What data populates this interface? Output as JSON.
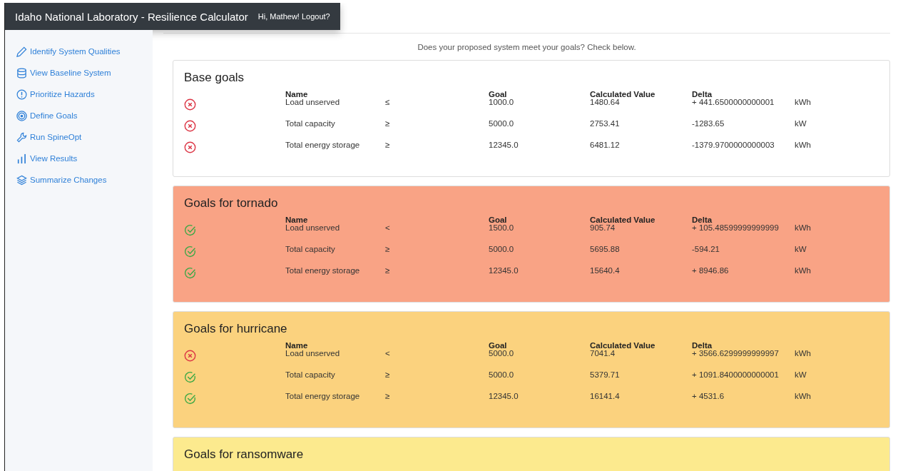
{
  "header": {
    "title": "Idaho National Laboratory - Resilience Calculator",
    "user_link": "Hi, Mathew! Logout?"
  },
  "sidebar": {
    "items": [
      {
        "label": "Identify System Qualities"
      },
      {
        "label": "View Baseline System"
      },
      {
        "label": "Prioritize Hazards"
      },
      {
        "label": "Define Goals"
      },
      {
        "label": "Run SpineOpt"
      },
      {
        "label": "View Results"
      },
      {
        "label": "Summarize Changes"
      }
    ]
  },
  "intro": "Does your proposed system meet your goals? Check below.",
  "cards": [
    {
      "title": "Base goals",
      "color": "#ffffff",
      "columns": [
        "Name",
        "Goal",
        "Calculated Value",
        "Delta"
      ],
      "rows": [
        {
          "met": false,
          "name": "Load unserved",
          "operator": "≤",
          "goal": "1000.0",
          "value": "1480.64",
          "delta": "+ 441.6500000000001",
          "unit": "kWh"
        },
        {
          "met": false,
          "name": "Total capacity",
          "operator": "≥",
          "goal": "5000.0",
          "value": "2753.41",
          "delta": "-1283.65",
          "unit": "kW"
        },
        {
          "met": false,
          "name": "Total energy storage",
          "operator": "≥",
          "goal": "12345.0",
          "value": "6481.12",
          "delta": "-1379.9700000000003",
          "unit": "kWh"
        }
      ]
    },
    {
      "title": "Goals for tornado",
      "color": "#f9a385",
      "columns": [
        "Name",
        "Goal",
        "Calculated Value",
        "Delta"
      ],
      "rows": [
        {
          "met": true,
          "name": "Load unserved",
          "operator": "<",
          "goal": "1500.0",
          "value": "905.74",
          "delta": "+ 105.48599999999999",
          "unit": "kWh"
        },
        {
          "met": true,
          "name": "Total capacity",
          "operator": "≥",
          "goal": "5000.0",
          "value": "5695.88",
          "delta": "-594.21",
          "unit": "kW"
        },
        {
          "met": true,
          "name": "Total energy storage",
          "operator": "≥",
          "goal": "12345.0",
          "value": "15640.4",
          "delta": "+ 8946.86",
          "unit": "kWh"
        }
      ]
    },
    {
      "title": "Goals for hurricane",
      "color": "#fbd27e",
      "columns": [
        "Name",
        "Goal",
        "Calculated Value",
        "Delta"
      ],
      "rows": [
        {
          "met": false,
          "name": "Load unserved",
          "operator": "<",
          "goal": "5000.0",
          "value": "7041.4",
          "delta": "+ 3566.6299999999997",
          "unit": "kWh"
        },
        {
          "met": true,
          "name": "Total capacity",
          "operator": "≥",
          "goal": "5000.0",
          "value": "5379.71",
          "delta": "+ 1091.8400000000001",
          "unit": "kW"
        },
        {
          "met": true,
          "name": "Total energy storage",
          "operator": "≥",
          "goal": "12345.0",
          "value": "16141.4",
          "delta": "+ 4531.6",
          "unit": "kWh"
        }
      ]
    },
    {
      "title": "Goals for ransomware",
      "color": "#fcea8e"
    }
  ]
}
